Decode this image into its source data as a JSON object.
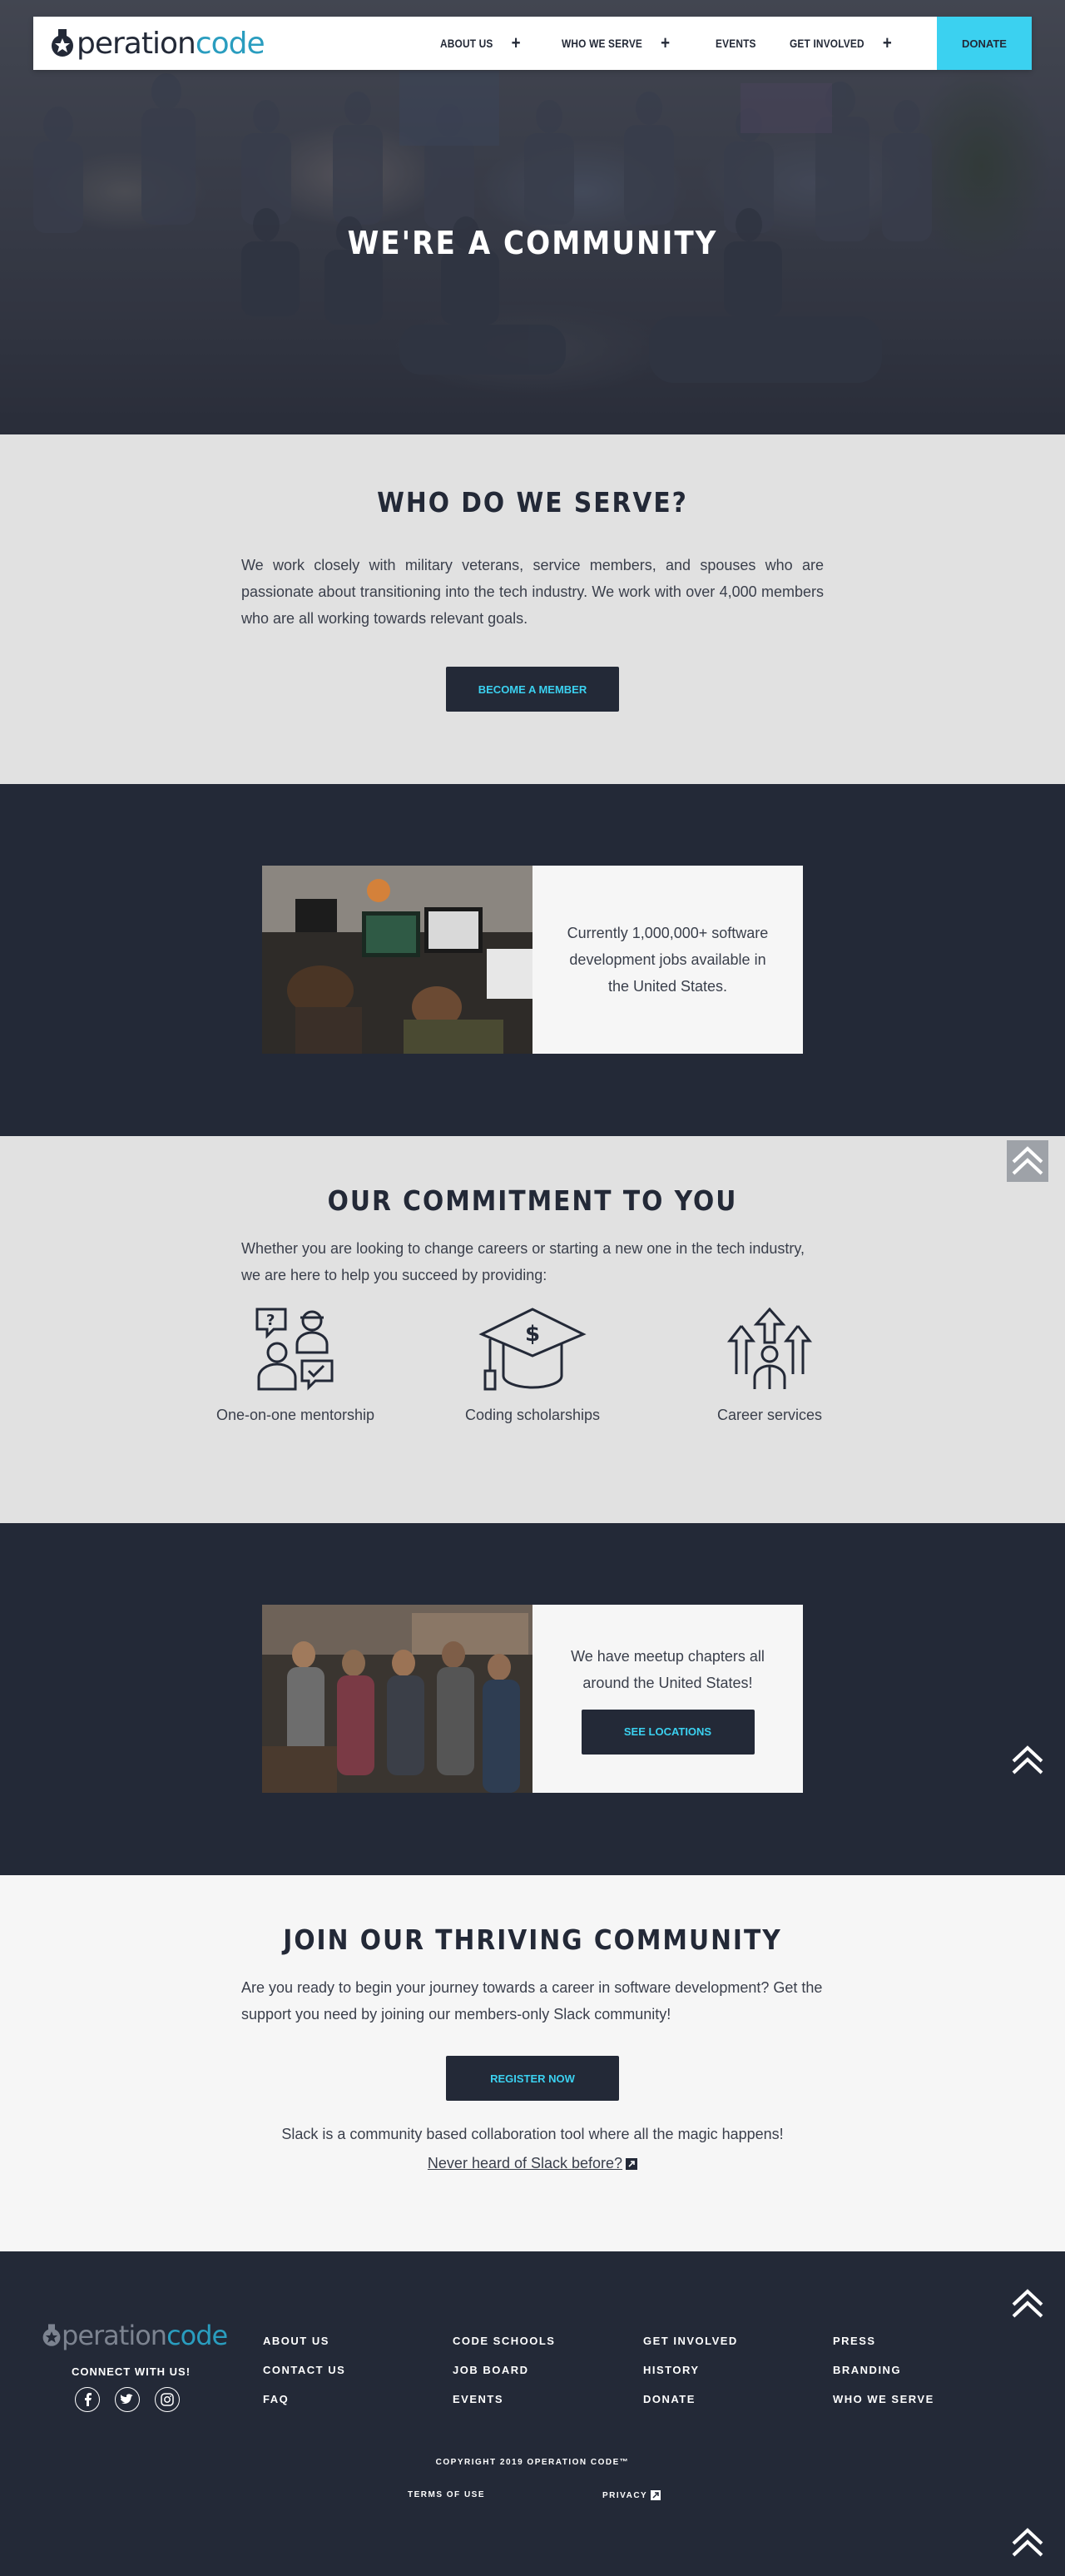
{
  "nav": {
    "logo_part1": "peration",
    "logo_part2": "code",
    "items": [
      {
        "label": "ABOUT US",
        "has_plus": true
      },
      {
        "label": "WHO WE SERVE",
        "has_plus": true
      },
      {
        "label": "EVENTS",
        "has_plus": false
      },
      {
        "label": "GET INVOLVED",
        "has_plus": true
      }
    ],
    "plus": "+",
    "donate": "DONATE"
  },
  "hero": {
    "title": "WE'RE A COMMUNITY"
  },
  "serve": {
    "title": "WHO DO WE SERVE?",
    "text": "We work closely with military veterans, service members, and spouses who are passionate about transitioning into the tech industry. We work with over 4,000 members who are all working towards relevant goals.",
    "button": "BECOME A MEMBER"
  },
  "jobs_card": {
    "text": "Currently 1,000,000+ software development jobs available in the United States."
  },
  "commitment": {
    "title": "OUR COMMITMENT TO YOU",
    "text": "Whether you are looking to change careers or starting a new one in the tech industry, we are here to help you succeed by providing:",
    "features": [
      {
        "label": "One-on-one mentorship",
        "icon": "mentorship-icon"
      },
      {
        "label": "Coding scholarships",
        "icon": "graduation-cap-icon"
      },
      {
        "label": "Career services",
        "icon": "career-arrows-icon"
      }
    ]
  },
  "meetup_card": {
    "text": "We have meetup chapters all around the United States!",
    "button": "SEE LOCATIONS"
  },
  "join": {
    "title": "JOIN OUR THRIVING COMMUNITY",
    "text": "Are you ready to begin your journey towards a career in software development? Get the support you need by joining our members-only Slack community!",
    "button": "REGISTER NOW",
    "slack_text": "Slack is a community based collaboration tool where all the magic happens!",
    "slack_link": "Never heard of Slack before?"
  },
  "footer": {
    "logo_part1": "peration",
    "logo_part2": "code",
    "connect": "CONNECT WITH US!",
    "social": [
      "facebook-icon",
      "twitter-icon",
      "instagram-icon"
    ],
    "col1": [
      "ABOUT US",
      "CONTACT US",
      "FAQ"
    ],
    "col2": [
      "CODE SCHOOLS",
      "JOB BOARD",
      "EVENTS"
    ],
    "col3": [
      "GET INVOLVED",
      "HISTORY",
      "DONATE"
    ],
    "col4": [
      "PRESS",
      "BRANDING",
      "WHO WE SERVE"
    ],
    "copyright": "COPYRIGHT 2019 OPERATION CODE™",
    "terms": "TERMS OF USE",
    "privacy": "PRIVACY"
  },
  "colors": {
    "navy": "#232937",
    "cyan": "#3bd1f0",
    "teal": "#2a9dbf",
    "light_gray": "#e1e1e1",
    "off_white": "#f6f6f6"
  }
}
